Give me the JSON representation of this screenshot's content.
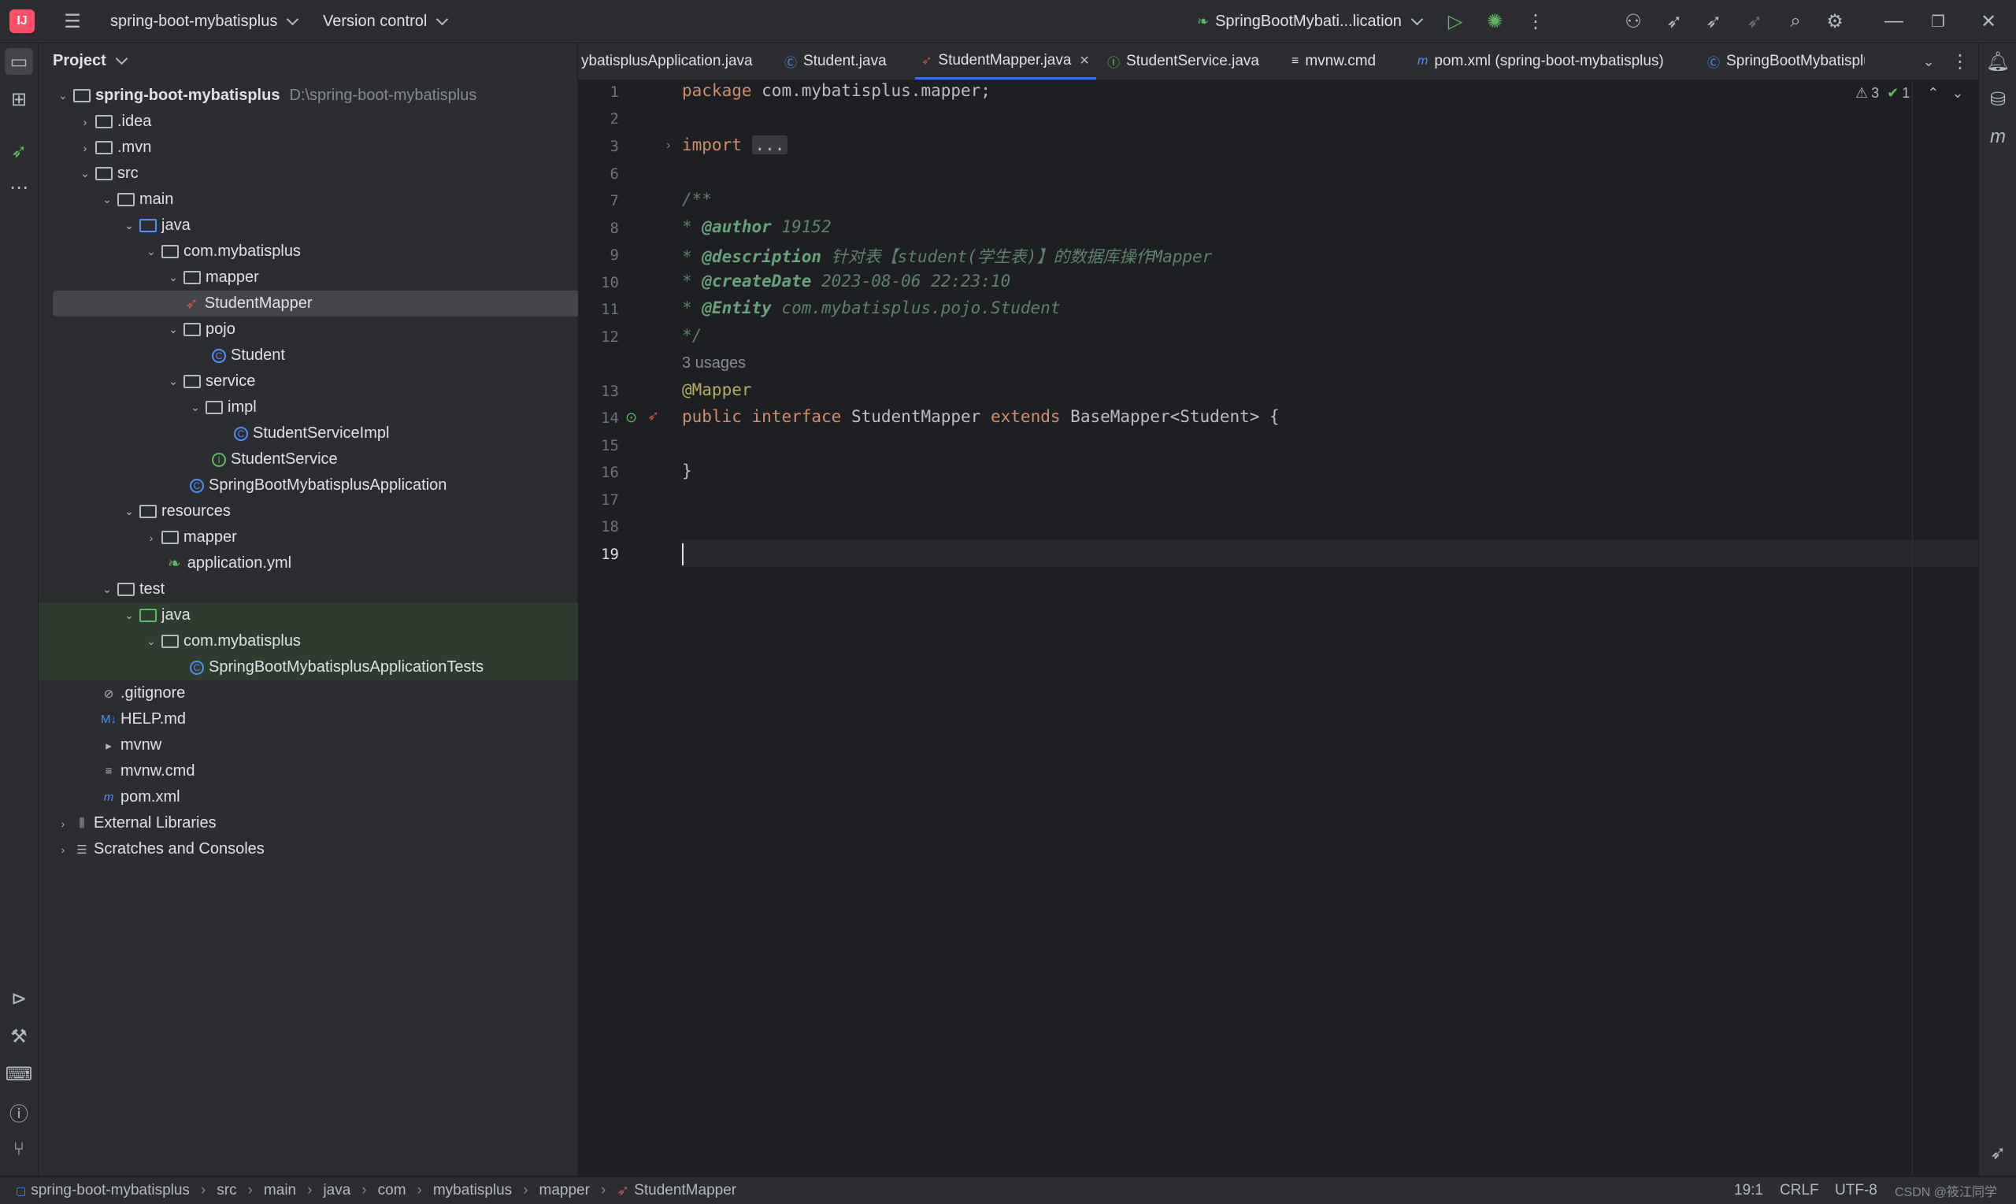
{
  "titlebar": {
    "project_name": "spring-boot-mybatisplus",
    "vcs_label": "Version control",
    "run_config": "SpringBootMybati...lication"
  },
  "project_panel": {
    "title": "Project",
    "root_name": "spring-boot-mybatisplus",
    "root_path": "D:\\spring-boot-mybatisplus",
    "items": [
      {
        "label": ".idea"
      },
      {
        "label": ".mvn"
      },
      {
        "label": "src"
      },
      {
        "label": "main"
      },
      {
        "label": "java"
      },
      {
        "label": "com.mybatisplus"
      },
      {
        "label": "mapper"
      },
      {
        "label": "StudentMapper"
      },
      {
        "label": "pojo"
      },
      {
        "label": "Student"
      },
      {
        "label": "service"
      },
      {
        "label": "impl"
      },
      {
        "label": "StudentServiceImpl"
      },
      {
        "label": "StudentService"
      },
      {
        "label": "SpringBootMybatisplusApplication"
      },
      {
        "label": "resources"
      },
      {
        "label": "mapper"
      },
      {
        "label": "application.yml"
      },
      {
        "label": "test"
      },
      {
        "label": "java"
      },
      {
        "label": "com.mybatisplus"
      },
      {
        "label": "SpringBootMybatisplusApplicationTests"
      },
      {
        "label": ".gitignore"
      },
      {
        "label": "HELP.md"
      },
      {
        "label": "mvnw"
      },
      {
        "label": "mvnw.cmd"
      },
      {
        "label": "pom.xml"
      },
      {
        "label": "External Libraries"
      },
      {
        "label": "Scratches and Consoles"
      }
    ]
  },
  "tabs": [
    {
      "label": "ybatisplusApplication.java"
    },
    {
      "label": "Student.java"
    },
    {
      "label": "StudentMapper.java"
    },
    {
      "label": "StudentService.java"
    },
    {
      "label": "mvnw.cmd"
    },
    {
      "label": "pom.xml (spring-boot-mybatisplus)"
    },
    {
      "label": "SpringBootMybatisplusA|"
    }
  ],
  "editor": {
    "inspections": {
      "warnings": "3",
      "ok": "1"
    },
    "line_numbers": [
      "1",
      "2",
      "3",
      "6",
      "7",
      "8",
      "9",
      "10",
      "11",
      "12",
      "13",
      "14",
      "15",
      "16",
      "17",
      "18",
      "19"
    ],
    "code": {
      "l1_kw": "package",
      "l1_rest": " com.mybatisplus.mapper;",
      "l3_kw": "import",
      "l3_fold": "...",
      "l7": "/**",
      "l8_star": "* ",
      "l8_tag": "@author",
      "l8_val": " 19152",
      "l9_star": "* ",
      "l9_tag": "@description",
      "l9_val": " 针对表【student(学生表)】的数据库操作Mapper",
      "l10_star": "* ",
      "l10_tag": "@createDate",
      "l10_val": " 2023-08-06 22:23:10",
      "l11_star": "* ",
      "l11_tag": "@Entity",
      "l11_val": " com.mybatisplus.pojo.Student",
      "l12": "*/",
      "usages": "3 usages",
      "l13": "@Mapper",
      "l14_kw1": "public",
      "l14_kw2": "interface",
      "l14_name": "StudentMapper",
      "l14_kw3": "extends",
      "l14_rest": "BaseMapper<Student> {",
      "l16": "}"
    }
  },
  "statusbar": {
    "breadcrumbs": [
      "spring-boot-mybatisplus",
      "src",
      "main",
      "java",
      "com",
      "mybatisplus",
      "mapper",
      "StudentMapper"
    ],
    "position": "19:1",
    "line_sep": "CRLF",
    "encoding": "UTF-8",
    "watermark": "CSDN @筱江同学"
  }
}
